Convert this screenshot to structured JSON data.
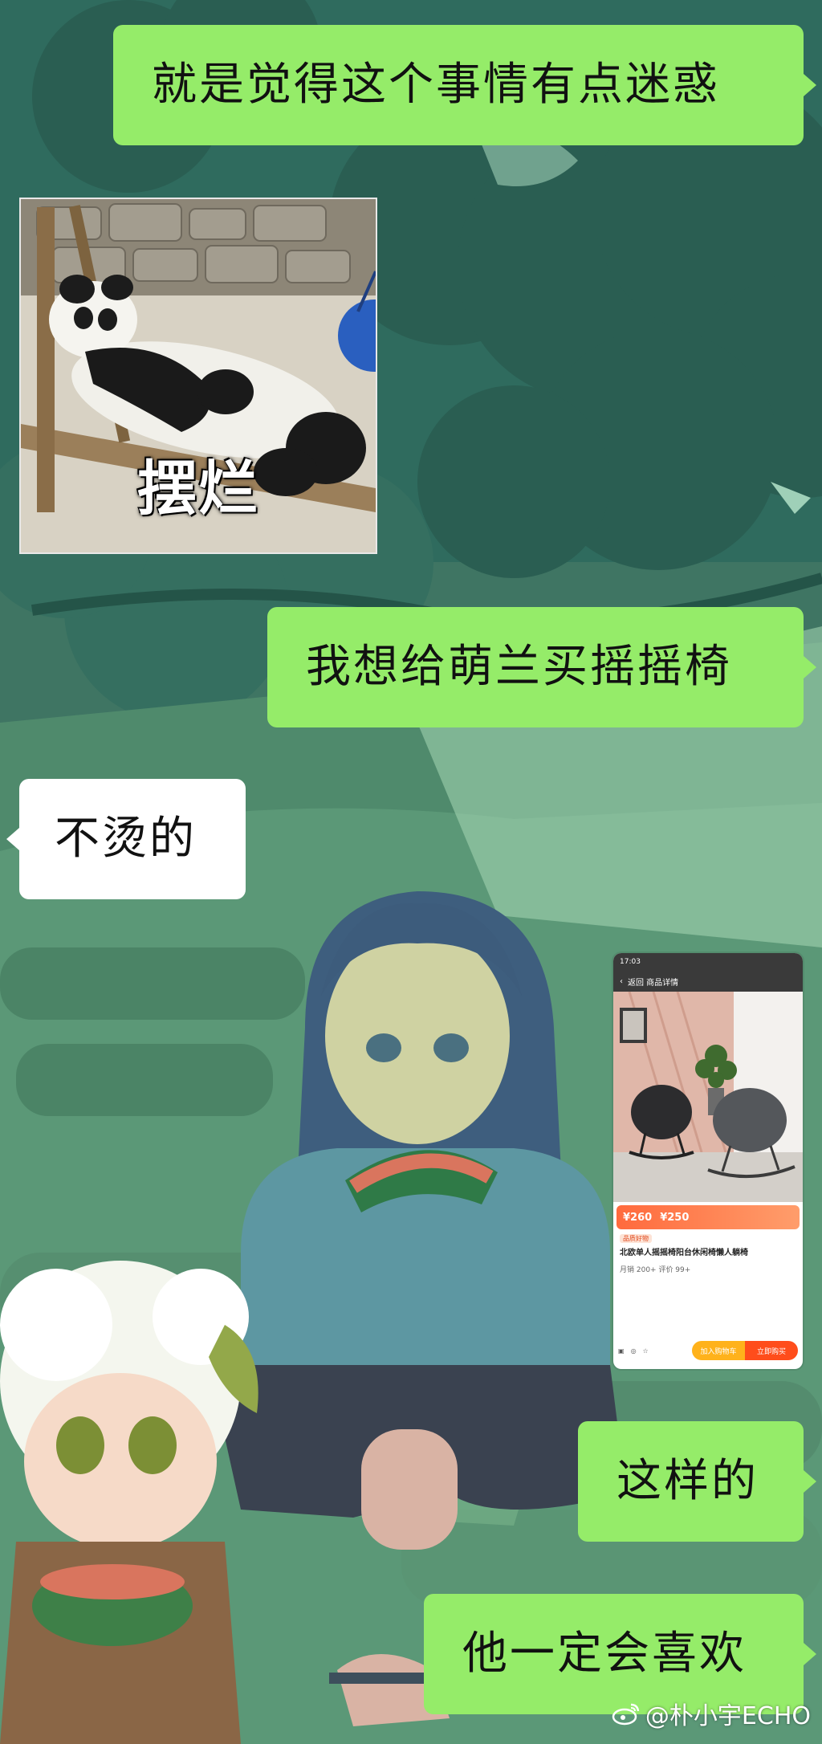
{
  "messages": [
    {
      "id": "m1",
      "direction": "out",
      "text": "就是觉得这个事情有点迷惑"
    },
    {
      "id": "m2",
      "direction": "in",
      "type": "sticker",
      "caption": "摆烂"
    },
    {
      "id": "m3",
      "direction": "out",
      "text": "我想给萌兰买摇摇椅"
    },
    {
      "id": "m4",
      "direction": "in",
      "text": "不烫的"
    },
    {
      "id": "m5",
      "direction": "out",
      "type": "image",
      "screenshot": {
        "status_time": "17:03",
        "title": "返回 商品详情",
        "price_now": "¥260",
        "price_orig": "¥250",
        "tag": "品质好物",
        "product_name": "北欧单人摇摇椅阳台休闲椅懒人躺椅",
        "meta": "月销 200+  评价 99+",
        "btn_cart": "加入购物车",
        "btn_buy": "立即购买"
      }
    },
    {
      "id": "m6",
      "direction": "out",
      "text": "这样的"
    },
    {
      "id": "m7",
      "direction": "out",
      "text": "他一定会喜欢"
    }
  ],
  "watermark": {
    "logo": "weibo-logo-icon",
    "text": "@朴小宇ECHO"
  },
  "colors": {
    "outgoing_bubble": "#95ec69",
    "incoming_bubble": "#ffffff",
    "background": "#3e7462"
  }
}
